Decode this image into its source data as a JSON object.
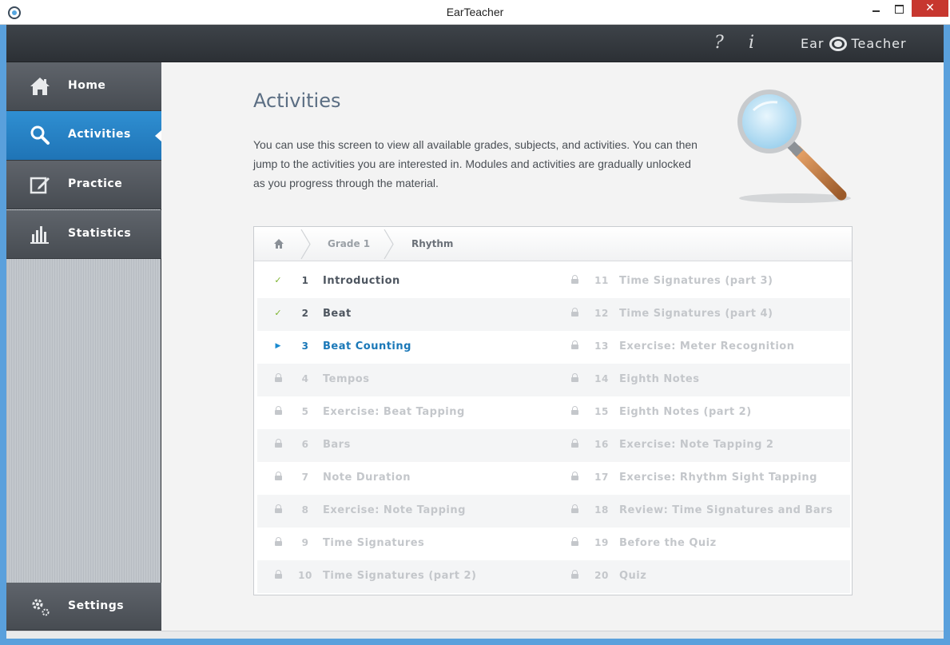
{
  "window": {
    "title": "EarTeacher"
  },
  "header": {
    "help_icon": "?",
    "info_icon": "i",
    "logo_left": "Ear",
    "logo_right": "Teacher"
  },
  "sidebar": {
    "items": [
      {
        "label": "Home",
        "icon": "home-icon"
      },
      {
        "label": "Activities",
        "icon": "search-icon",
        "active": true
      },
      {
        "label": "Practice",
        "icon": "edit-icon"
      },
      {
        "label": "Statistics",
        "icon": "bar-chart-icon"
      }
    ],
    "settings": {
      "label": "Settings",
      "icon": "gear-icon"
    }
  },
  "main": {
    "title": "Activities",
    "intro": "You can use this screen to view all available grades, subjects, and activities.  You can then jump to the activities you are interested in.  Modules and activities are gradually unlocked as you progress through the material.",
    "breadcrumb": {
      "home_icon": "home-icon",
      "grade": "Grade 1",
      "subject": "Rhythm"
    },
    "activities": [
      {
        "num": "1",
        "label": "Introduction",
        "status": "done"
      },
      {
        "num": "2",
        "label": "Beat",
        "status": "done"
      },
      {
        "num": "3",
        "label": "Beat Counting",
        "status": "current"
      },
      {
        "num": "4",
        "label": "Tempos",
        "status": "locked"
      },
      {
        "num": "5",
        "label": "Exercise: Beat Tapping",
        "status": "locked"
      },
      {
        "num": "6",
        "label": "Bars",
        "status": "locked"
      },
      {
        "num": "7",
        "label": "Note Duration",
        "status": "locked"
      },
      {
        "num": "8",
        "label": "Exercise: Note Tapping",
        "status": "locked"
      },
      {
        "num": "9",
        "label": "Time Signatures",
        "status": "locked"
      },
      {
        "num": "10",
        "label": "Time Signatures (part 2)",
        "status": "locked"
      },
      {
        "num": "11",
        "label": "Time Signatures (part 3)",
        "status": "locked"
      },
      {
        "num": "12",
        "label": "Time Signatures (part 4)",
        "status": "locked"
      },
      {
        "num": "13",
        "label": "Exercise: Meter Recognition",
        "status": "locked"
      },
      {
        "num": "14",
        "label": "Eighth Notes",
        "status": "locked"
      },
      {
        "num": "15",
        "label": "Eighth Notes (part 2)",
        "status": "locked"
      },
      {
        "num": "16",
        "label": "Exercise: Note Tapping 2",
        "status": "locked"
      },
      {
        "num": "17",
        "label": "Exercise: Rhythm Sight Tapping",
        "status": "locked"
      },
      {
        "num": "18",
        "label": "Review: Time Signatures and Bars",
        "status": "locked"
      },
      {
        "num": "19",
        "label": "Before the Quiz",
        "status": "locked"
      },
      {
        "num": "20",
        "label": "Quiz",
        "status": "locked"
      }
    ]
  },
  "colors": {
    "accent": "#1a78b8",
    "done": "#7cb32e",
    "locked": "#c4c7cb",
    "sidebar_active": "#2a86c9"
  }
}
